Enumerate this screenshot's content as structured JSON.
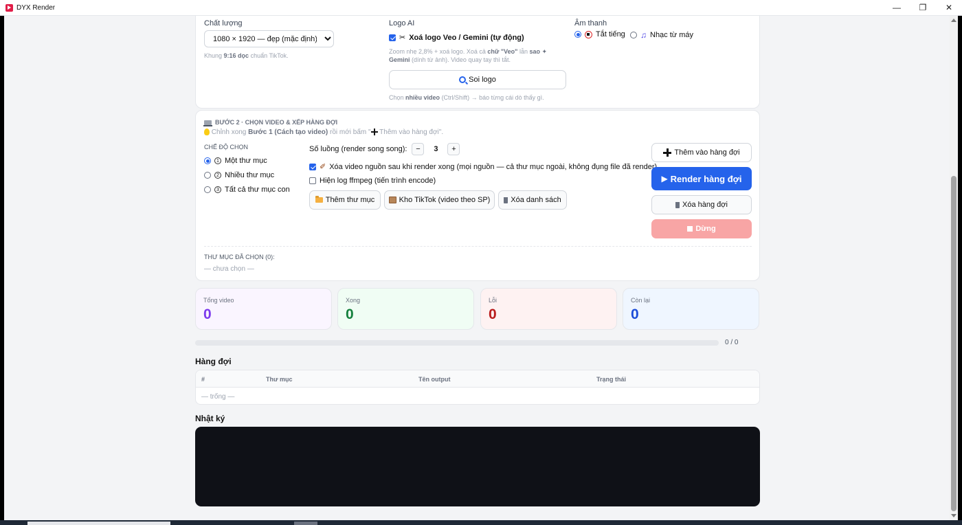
{
  "window": {
    "title": "DYX Render"
  },
  "quality": {
    "label": "Chất lượng",
    "selected": "1080 × 1920 — đẹp (mặc định)",
    "hint_prefix": "Khung",
    "hint_bold": "9:16 dọc",
    "hint_suffix": "chuẩn TikTok."
  },
  "logo_ai": {
    "label": "Logo AI",
    "remove_label": "Xoá logo Veo / Gemini (tự động)",
    "remove_checked": true,
    "hint_1": "Zoom nhẹ 2,8% + xoá logo. Xoá cả",
    "hint_bold_1": "chữ \"Veo\"",
    "hint_2": "lẫn",
    "hint_bold_2": "sao ✦ Gemini",
    "hint_3": "(dính từ ảnh). Video quay tay thì tắt.",
    "inspect_button": "Soi logo",
    "inspect_hint_1": "Chọn",
    "inspect_hint_bold": "nhiều video",
    "inspect_hint_2": "(Ctrl/Shift) → báo từng cái dò thấy gì."
  },
  "audio": {
    "label": "Âm thanh",
    "options": [
      {
        "label": "Tắt tiếng",
        "selected": true
      },
      {
        "label": "Nhạc từ máy",
        "selected": false
      }
    ]
  },
  "step2": {
    "title": "BƯỚC 2 · CHỌN VIDEO & XẾP HÀNG ĐỢI",
    "hint_1": "Chỉnh xong",
    "hint_bold": "Bước 1 (Cách tạo video)",
    "hint_2": "rồi mới bấm \"",
    "hint_3": "Thêm vào hàng đợi\".",
    "mode_label": "CHẾ ĐỘ CHỌN",
    "modes": [
      {
        "num": "1",
        "label": "Một thư mục",
        "selected": true
      },
      {
        "num": "2",
        "label": "Nhiều thư mục",
        "selected": false
      },
      {
        "num": "3",
        "label": "Tất cả thư mục con",
        "selected": false
      }
    ],
    "threads_label": "Số luồng (render song song):",
    "threads_value": "3",
    "threads_minus": "−",
    "threads_plus": "+",
    "delete_source_label": "Xóa video nguồn sau khi render xong (mọi nguồn — cả thư mục ngoài, không đụng file đã render)",
    "delete_source_checked": true,
    "show_log_label": "Hiện log ffmpeg (tiến trình encode)",
    "show_log_checked": false,
    "add_folder_button": "Thêm thư mục",
    "tiktok_store_button": "Kho TikTok (video theo SP)",
    "clear_list_button": "Xóa danh sách",
    "add_queue_button": "Thêm vào hàng đợi",
    "render_queue_button": "Render hàng đợi",
    "clear_queue_button": "Xóa hàng đợi",
    "stop_button": "Dừng",
    "selected_folders_label": "THƯ MỤC ĐÃ CHỌN (0):",
    "selected_folders_empty": "— chưa chọn —"
  },
  "stats": [
    {
      "label": "Tổng video",
      "value": "0",
      "color": "#7c3aed",
      "bg": "#faf5ff"
    },
    {
      "label": "Xong",
      "value": "0",
      "color": "#15803d",
      "bg": "#f0fdf4"
    },
    {
      "label": "Lỗi",
      "value": "0",
      "color": "#b91c1c",
      "bg": "#fef2f2"
    },
    {
      "label": "Còn lại",
      "value": "0",
      "color": "#1d4ed8",
      "bg": "#eff6ff"
    }
  ],
  "progress": {
    "text": "0 / 0",
    "fraction": 0
  },
  "queue": {
    "title": "Hàng đợi",
    "columns": [
      "#",
      "Thư mục",
      "Tên output",
      "Trạng thái"
    ],
    "empty": "— trống —"
  },
  "log": {
    "title": "Nhật ký"
  },
  "colors": {
    "primary": "#2563eb",
    "stop": "#f8a5a5"
  }
}
